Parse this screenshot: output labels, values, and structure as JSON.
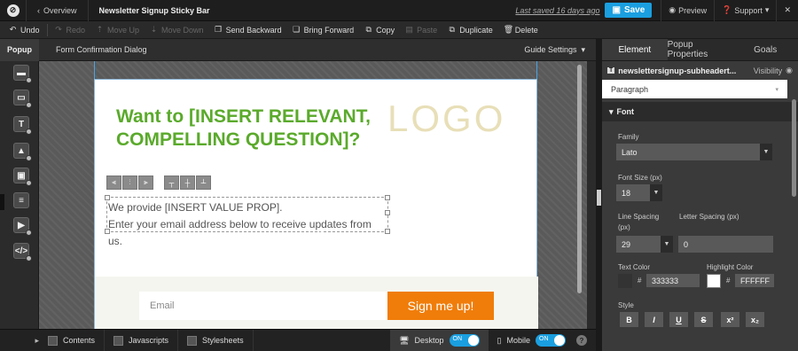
{
  "topbar": {
    "overview": "Overview",
    "title": "Newsletter Signup Sticky Bar",
    "last_saved": "Last saved  16 days ago",
    "save": "Save",
    "preview": "Preview",
    "support": "Support"
  },
  "toolbar": {
    "undo": "Undo",
    "redo": "Redo",
    "move_up": "Move Up",
    "move_down": "Move Down",
    "send_backward": "Send Backward",
    "bring_forward": "Bring Forward",
    "copy": "Copy",
    "paste": "Paste",
    "duplicate": "Duplicate",
    "delete": "Delete"
  },
  "subbar": {
    "popup_tab": "Popup",
    "form_dialog": "Form Confirmation Dialog",
    "guide_settings": "Guide Settings"
  },
  "canvas": {
    "headline": "Want to [INSERT RELEVANT, COMPELLING QUESTION]?",
    "logo": "LOGO",
    "sub_line1": "We provide [INSERT VALUE PROP].",
    "sub_line2": "Enter your email address below to receive updates from us.",
    "email_placeholder": "Email",
    "signup_button": "Sign me up!"
  },
  "bottombar": {
    "contents": "Contents",
    "javascripts": "Javascripts",
    "stylesheets": "Stylesheets",
    "desktop": "Desktop",
    "mobile": "Mobile",
    "toggle_on": "ON",
    "help": "?"
  },
  "rpanel": {
    "tabs": [
      "Element",
      "Popup Properties",
      "Goals"
    ],
    "element_name": "newslettersignup-subheadert...",
    "visibility": "Visibility",
    "paragraph": "Paragraph",
    "font_section": "Font",
    "family_label": "Family",
    "family_value": "Lato",
    "font_size_label": "Font Size (px)",
    "font_size_value": "18",
    "line_spacing_label": "Line Spacing",
    "line_spacing_unit": "(px)",
    "line_spacing_value": "29",
    "letter_spacing_label": "Letter Spacing (px)",
    "letter_spacing_value": "0",
    "text_color_label": "Text Color",
    "text_color_value": "333333",
    "highlight_color_label": "Highlight Color",
    "highlight_color_value": "FFFFFF",
    "hash": "#",
    "style_label": "Style",
    "style_buttons": [
      "B",
      "I",
      "U",
      "S",
      "x²",
      "x₂"
    ]
  },
  "colors": {
    "accent": "#1a9fe0",
    "headline_green": "#5aaa2b",
    "signup_orange": "#f07d0a",
    "text_color": "#333333",
    "highlight_color": "#ffffff"
  }
}
